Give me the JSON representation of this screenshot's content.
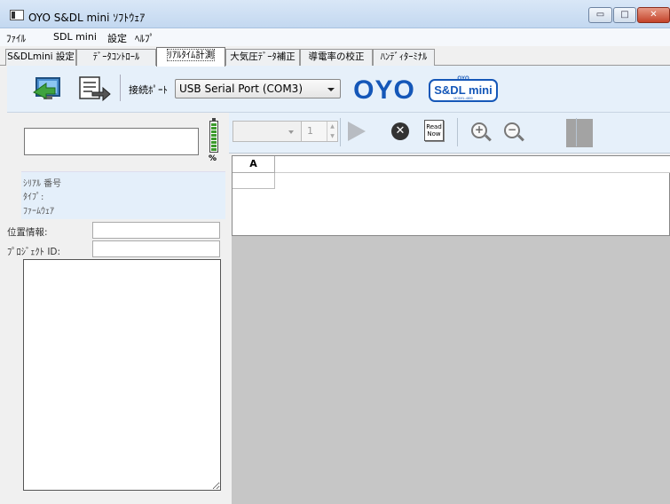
{
  "window": {
    "title": "OYO S&DL mini ｿﾌﾄｳｪｱ",
    "buttons": {
      "minimize": "▭",
      "maximize": "□",
      "close": "✕"
    }
  },
  "menu": [
    "ﾌｧｲﾙ",
    "SDL mini",
    "設定",
    "ﾍﾙﾌﾟ"
  ],
  "tabs": [
    {
      "label": "S&DLmini 設定",
      "active": false
    },
    {
      "label": "ﾃﾞｰﾀｺﾝﾄﾛｰﾙ",
      "active": false
    },
    {
      "label": "ﾘｱﾙﾀｲﾑ計測",
      "active": true
    },
    {
      "label": "大気圧ﾃﾞｰﾀ補正",
      "active": false
    },
    {
      "label": "導電率の校正",
      "active": false
    },
    {
      "label": "ﾊﾝﾃﾞｨﾀｰﾐﾅﾙ",
      "active": false
    }
  ],
  "toolbar": {
    "port_label": "接続ﾎﾟｰﾄ",
    "port_value": "USB Serial Port (COM3)",
    "logo_oyo": "OYO",
    "logo_sdl_top": "OYO",
    "logo_sdl": "S&DL mini",
    "logo_sdl_model": "MODEL-4800"
  },
  "left": {
    "battery_unit": "%",
    "battery_level_cells": 8,
    "info": {
      "serial": "ｼﾘｱﾙ 番号",
      "type": "ﾀｲﾌﾟ:",
      "firmware": "ﾌｧｰﾑｳｪｱ"
    },
    "location_label": "位置情報:",
    "project_label": "ﾌﾟﾛｼﾞｪｸﾄ ID:"
  },
  "realtime": {
    "channel_value": "1",
    "readnow_label": "Read\nNow",
    "spin_up": "▲",
    "spin_down": "▼",
    "stop_label": "✕",
    "zoom_in": "+",
    "zoom_out": "−",
    "grid_columns": [
      "A"
    ],
    "swatch_color": "#a3a3a3"
  }
}
